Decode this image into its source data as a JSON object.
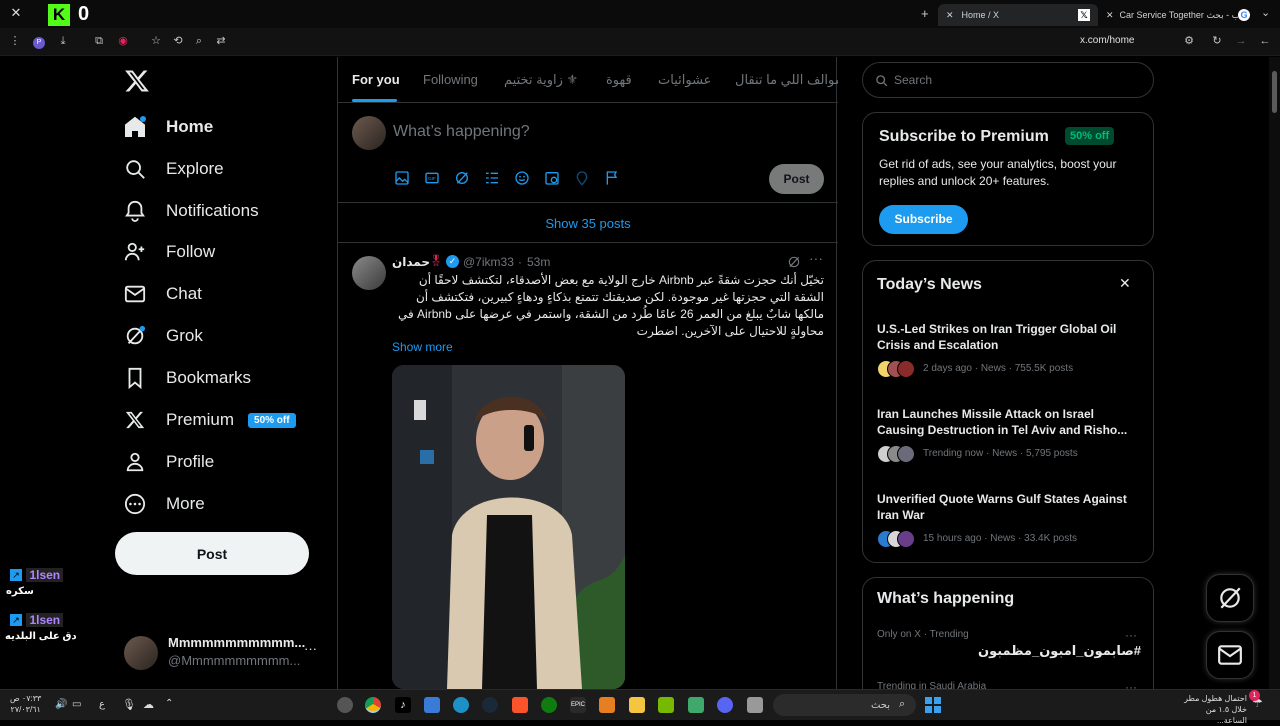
{
  "browser": {
    "tabs": [
      {
        "label": "Home / X",
        "active": true
      },
      {
        "label": "Car Service Together ريب - بحث",
        "active": false
      }
    ],
    "url": "x.com/home",
    "overlay_counter": "0",
    "overlay_letter": "K"
  },
  "nav": {
    "items": [
      {
        "label": "Home",
        "icon": "home-icon"
      },
      {
        "label": "Explore",
        "icon": "search-icon"
      },
      {
        "label": "Notifications",
        "icon": "bell-icon"
      },
      {
        "label": "Follow",
        "icon": "person-add-icon"
      },
      {
        "label": "Chat",
        "icon": "mail-icon"
      },
      {
        "label": "Grok",
        "icon": "grok-icon"
      },
      {
        "label": "Bookmarks",
        "icon": "bookmark-icon"
      },
      {
        "label": "Premium",
        "icon": "x-icon"
      },
      {
        "label": "Profile",
        "icon": "person-icon"
      },
      {
        "label": "More",
        "icon": "more-circle-icon"
      }
    ],
    "premium_badge": "50% off",
    "post_label": "Post",
    "account_name": "Mmmmmmmmmmm...",
    "account_handle": "@Mmmmmmmmmm...",
    "account_more": "···"
  },
  "feed": {
    "tabs": [
      "For you",
      "Following",
      "زاوية تختيم ⚜",
      "قهوة",
      "عشوائيات",
      "سوالف اللي ما تنقال"
    ],
    "composer_placeholder": "What’s happening?",
    "composer_post": "Post",
    "show_posts": "Show 35 posts",
    "tweet": {
      "name": "حمدان",
      "handle": "@7ikm33",
      "time": "53m",
      "text": "تخيّل أنك حجزت شقةً عبر Airbnb خارج الولاية مع بعض الأصدقاء، لتكتشف لاحقًا أن الشقة التي حجزتها غير موجودة. لكن صديقتك تتمتع بذكاءٍ ودهاءٍ كبيرين، فتكتشف أن مالكها شابٌ يبلغ من العمر 26 عامًا طُرد من الشقة، واستمر في عرضها على Airbnb في محاولةٍ للاحتيال على الآخرين. اضطرت",
      "show_more": "Show more"
    }
  },
  "sidebar": {
    "search_placeholder": "Search",
    "premium": {
      "title": "Subscribe to Premium",
      "badge": "50% off",
      "body": "Get rid of ads, see your analytics, boost your replies and unlock 20+ features.",
      "button": "Subscribe"
    },
    "news": {
      "title": "Today’s News",
      "items": [
        {
          "headline": "U.S.-Led Strikes on Iran Trigger Global Oil Crisis and Escalation",
          "meta": "2 days ago · News · 755.5K posts"
        },
        {
          "headline": "Iran Launches Missile Attack on Israel Causing Destruction in Tel Aviv and Risho...",
          "meta": "Trending now · News · 5,795 posts"
        },
        {
          "headline": "Unverified Quote Warns Gulf States Against Iran War",
          "meta": "15 hours ago · News · 33.4K posts"
        }
      ]
    },
    "happening": {
      "title": "What’s happening",
      "items": [
        {
          "context": "Only on X · Trending",
          "topic": "#صابمون_امبون_مظمبون"
        },
        {
          "context": "Trending in Saudi Arabia",
          "topic": ""
        }
      ]
    }
  },
  "stream_overlay": [
    {
      "user": "1lsen",
      "message": "سكره"
    },
    {
      "user": "1lsen",
      "message": "دق على البلديه"
    }
  ],
  "taskbar": {
    "search_placeholder": "بحث",
    "time": "٠٧:٣٣ ص",
    "date": "٢٧/٠٣/٦١",
    "weather_title": "احتمال هطول مطر",
    "weather_sub": "خلال ١.٥ من الساعة...",
    "language": "ع",
    "notification_count": "1"
  },
  "colors": {
    "accent": "#1d9bf0",
    "premium_green": "#00ba7c",
    "background": "#000000"
  }
}
